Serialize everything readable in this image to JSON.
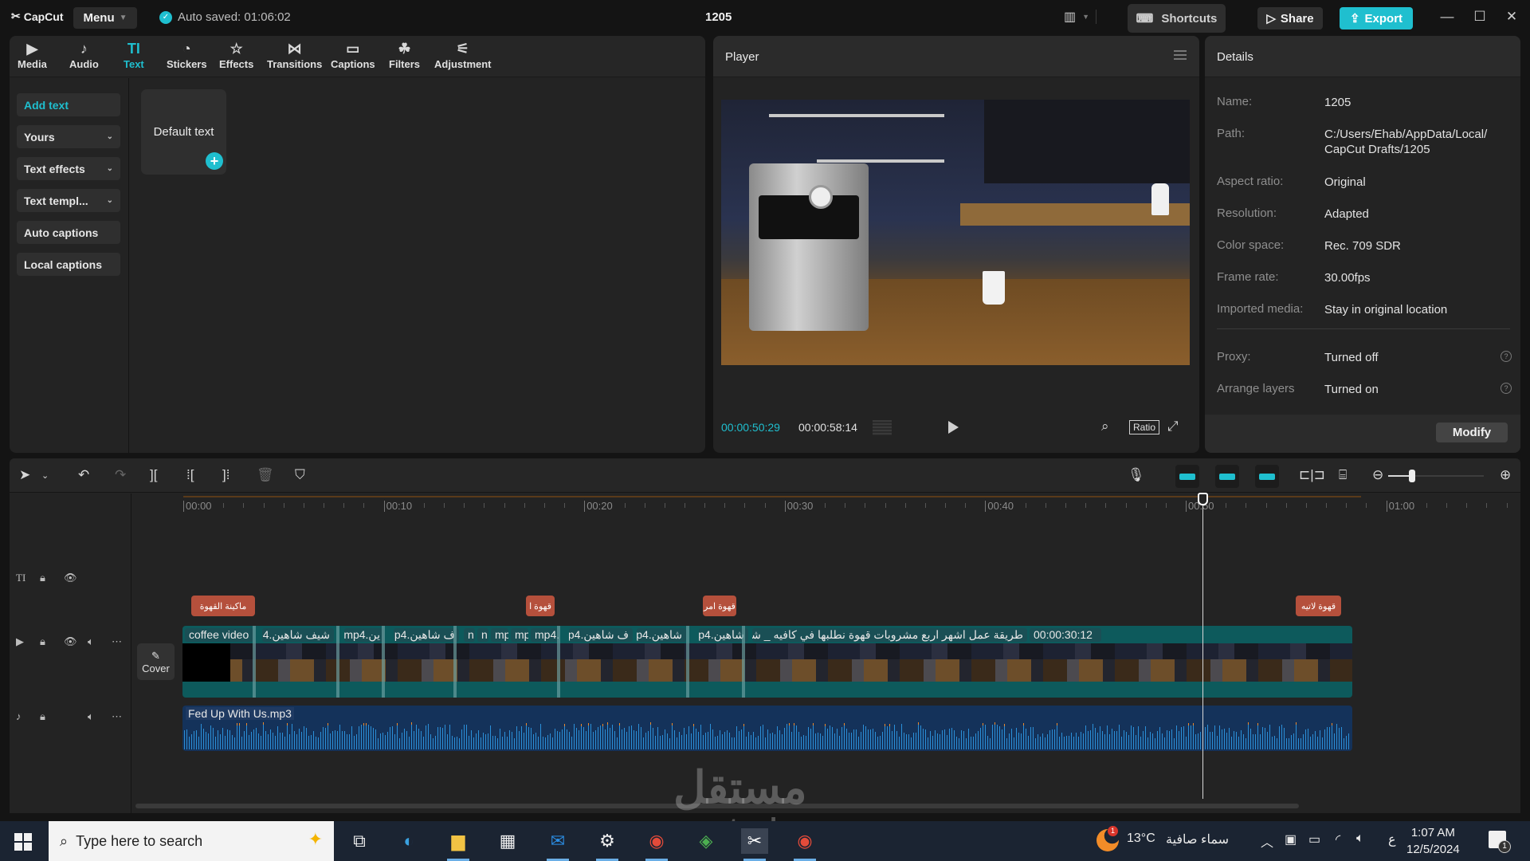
{
  "app": {
    "logo": "CapCut",
    "menu_label": "Menu",
    "autosave": "Auto saved: 01:06:02",
    "project_title": "1205",
    "shortcuts_label": "Shortcuts",
    "share_label": "Share",
    "export_label": "Export",
    "accent_color": "#1fbfcf"
  },
  "tabs": [
    {
      "label": "Media",
      "icon": "media-icon"
    },
    {
      "label": "Audio",
      "icon": "audio-icon"
    },
    {
      "label": "Text",
      "icon": "text-icon",
      "active": true
    },
    {
      "label": "Stickers",
      "icon": "stickers-icon"
    },
    {
      "label": "Effects",
      "icon": "effects-icon"
    },
    {
      "label": "Transitions",
      "icon": "transitions-icon"
    },
    {
      "label": "Captions",
      "icon": "captions-icon"
    },
    {
      "label": "Filters",
      "icon": "filters-icon"
    },
    {
      "label": "Adjustment",
      "icon": "adjustment-icon"
    }
  ],
  "side_items": [
    {
      "label": "Add text",
      "active": true
    },
    {
      "label": "Yours",
      "dropdown": true
    },
    {
      "label": "Text effects",
      "dropdown": true
    },
    {
      "label": "Text templ...",
      "dropdown": true
    },
    {
      "label": "Auto captions"
    },
    {
      "label": "Local captions"
    }
  ],
  "text_card": {
    "label": "Default text"
  },
  "player": {
    "title": "Player",
    "current_time": "00:00:50:29",
    "total_time": "00:00:58:14",
    "ratio_label": "Ratio"
  },
  "details": {
    "title": "Details",
    "rows": [
      {
        "label": "Name:",
        "value": "1205"
      },
      {
        "label": "Path:",
        "value": "C:/Users/Ehab/AppData/Local/ CapCut Drafts/1205"
      },
      {
        "label": "Aspect ratio:",
        "value": "Original"
      },
      {
        "label": "Resolution:",
        "value": "Adapted"
      },
      {
        "label": "Color space:",
        "value": "Rec. 709 SDR"
      },
      {
        "label": "Frame rate:",
        "value": "30.00fps"
      },
      {
        "label": "Imported media:",
        "value": "Stay in original location"
      },
      {
        "label": "Proxy:",
        "value": "Turned off"
      },
      {
        "label": "Arrange layers",
        "value": "Turned on"
      }
    ],
    "modify_label": "Modify"
  },
  "timeline": {
    "ruler_labels": [
      "00:00",
      "00:10",
      "00:20",
      "00:30",
      "00:40",
      "00:50",
      "01:00"
    ],
    "playhead_time": "00:00:50:29",
    "zoom_level_fraction": 0.25,
    "cover_label": "Cover",
    "text_clips": [
      {
        "label": "ماكينة القهوة"
      },
      {
        "label": "قهوة ا"
      },
      {
        "label": "قهوة امر"
      },
      {
        "label": "قهوة لاتيه"
      }
    ],
    "video_clips": [
      {
        "label": "coffee video"
      },
      {
        "label": "شيف شاهين.mp4"
      },
      {
        "label": "ين.mp4"
      },
      {
        "label": "ف شاهين.mp4"
      },
      {
        "label": "n"
      },
      {
        "label": "n"
      },
      {
        "label": "mp"
      },
      {
        "label": "mp"
      },
      {
        "label": "mp4."
      },
      {
        "label": "ف شاهين.mp4"
      },
      {
        "label": "شاهين.mp4"
      },
      {
        "label": "شاهين.mp4"
      },
      {
        "label": "طريقة عمل اشهر اربع مشروبات قهوة نطلبها في كافيه _ شيف شاهين.mp4"
      }
    ],
    "long_clip_duration": "00:00:30:12",
    "audio_clip": {
      "label": "Fed Up With Us.mp3"
    }
  },
  "taskbar": {
    "search_placeholder": "Type here to search",
    "apps": [
      "task-view",
      "edge",
      "file-explorer",
      "microsoft-store",
      "mail",
      "settings",
      "chrome",
      "idm",
      "capcut",
      "chrome-profile"
    ],
    "weather_temp": "13°C",
    "weather_desc": "سماء صافية",
    "weather_badge": "1",
    "language": "ع",
    "time": "1:07 AM",
    "date": "12/5/2024",
    "notification_count": "1"
  },
  "watermark": {
    "line1": "مستقل",
    "line2": "mostaql.com"
  }
}
